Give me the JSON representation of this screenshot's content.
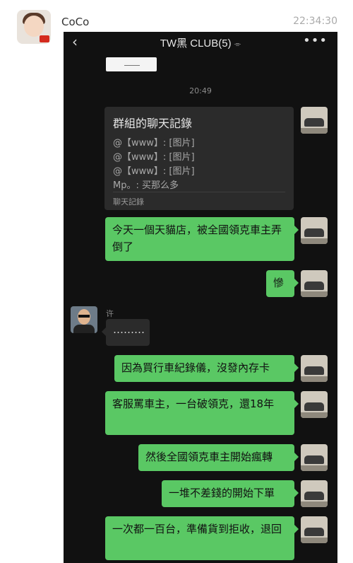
{
  "post": {
    "username": "CoCo",
    "time": "22:34:30"
  },
  "chat": {
    "title": "TW黑 CLUB(5)",
    "back_icon": "chevron-left-icon",
    "mute_icon": "bell-off-icon",
    "more_icon": "more-dots-icon",
    "timestamp": "20:49",
    "forwarded_card": {
      "title": "群組的聊天記錄",
      "lines": [
        "@【www】: [图片]",
        "@【www】: [图片]",
        "@【www】: [图片]",
        "Mp。: 买那么多"
      ],
      "footer": "聊天記錄"
    },
    "incoming_sender": "许",
    "messages": [
      "今天一個天貓店，被全國領克車主弄倒了",
      "慘",
      "………",
      "因為買行車紀錄儀，沒發內存卡",
      "客服罵車主，一台破領克，還18年",
      "然後全國領克車主開始瘋轉",
      "一堆不差錢的開始下單",
      "一次都一百台，準備貨到拒收，退回"
    ]
  }
}
